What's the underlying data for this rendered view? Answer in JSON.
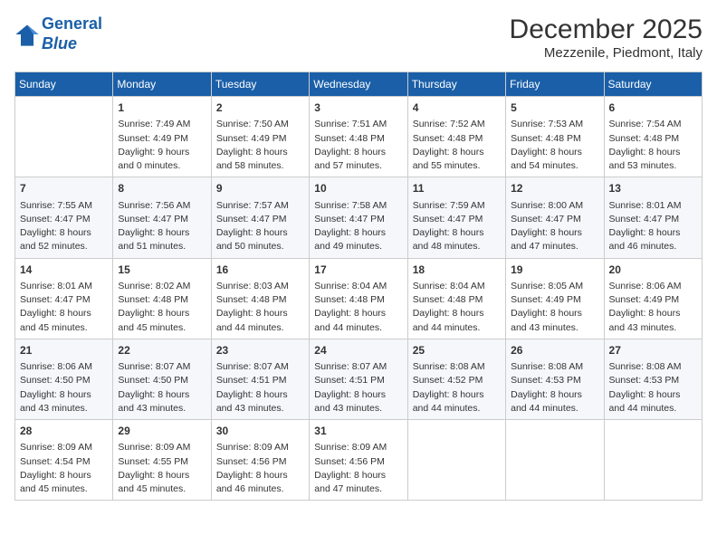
{
  "header": {
    "logo_line1": "General",
    "logo_line2": "Blue",
    "title": "December 2025",
    "subtitle": "Mezzenile, Piedmont, Italy"
  },
  "days_of_week": [
    "Sunday",
    "Monday",
    "Tuesday",
    "Wednesday",
    "Thursday",
    "Friday",
    "Saturday"
  ],
  "weeks": [
    [
      {
        "day": "",
        "info": ""
      },
      {
        "day": "1",
        "info": "Sunrise: 7:49 AM\nSunset: 4:49 PM\nDaylight: 9 hours\nand 0 minutes."
      },
      {
        "day": "2",
        "info": "Sunrise: 7:50 AM\nSunset: 4:49 PM\nDaylight: 8 hours\nand 58 minutes."
      },
      {
        "day": "3",
        "info": "Sunrise: 7:51 AM\nSunset: 4:48 PM\nDaylight: 8 hours\nand 57 minutes."
      },
      {
        "day": "4",
        "info": "Sunrise: 7:52 AM\nSunset: 4:48 PM\nDaylight: 8 hours\nand 55 minutes."
      },
      {
        "day": "5",
        "info": "Sunrise: 7:53 AM\nSunset: 4:48 PM\nDaylight: 8 hours\nand 54 minutes."
      },
      {
        "day": "6",
        "info": "Sunrise: 7:54 AM\nSunset: 4:48 PM\nDaylight: 8 hours\nand 53 minutes."
      }
    ],
    [
      {
        "day": "7",
        "info": "Sunrise: 7:55 AM\nSunset: 4:47 PM\nDaylight: 8 hours\nand 52 minutes."
      },
      {
        "day": "8",
        "info": "Sunrise: 7:56 AM\nSunset: 4:47 PM\nDaylight: 8 hours\nand 51 minutes."
      },
      {
        "day": "9",
        "info": "Sunrise: 7:57 AM\nSunset: 4:47 PM\nDaylight: 8 hours\nand 50 minutes."
      },
      {
        "day": "10",
        "info": "Sunrise: 7:58 AM\nSunset: 4:47 PM\nDaylight: 8 hours\nand 49 minutes."
      },
      {
        "day": "11",
        "info": "Sunrise: 7:59 AM\nSunset: 4:47 PM\nDaylight: 8 hours\nand 48 minutes."
      },
      {
        "day": "12",
        "info": "Sunrise: 8:00 AM\nSunset: 4:47 PM\nDaylight: 8 hours\nand 47 minutes."
      },
      {
        "day": "13",
        "info": "Sunrise: 8:01 AM\nSunset: 4:47 PM\nDaylight: 8 hours\nand 46 minutes."
      }
    ],
    [
      {
        "day": "14",
        "info": "Sunrise: 8:01 AM\nSunset: 4:47 PM\nDaylight: 8 hours\nand 45 minutes."
      },
      {
        "day": "15",
        "info": "Sunrise: 8:02 AM\nSunset: 4:48 PM\nDaylight: 8 hours\nand 45 minutes."
      },
      {
        "day": "16",
        "info": "Sunrise: 8:03 AM\nSunset: 4:48 PM\nDaylight: 8 hours\nand 44 minutes."
      },
      {
        "day": "17",
        "info": "Sunrise: 8:04 AM\nSunset: 4:48 PM\nDaylight: 8 hours\nand 44 minutes."
      },
      {
        "day": "18",
        "info": "Sunrise: 8:04 AM\nSunset: 4:48 PM\nDaylight: 8 hours\nand 44 minutes."
      },
      {
        "day": "19",
        "info": "Sunrise: 8:05 AM\nSunset: 4:49 PM\nDaylight: 8 hours\nand 43 minutes."
      },
      {
        "day": "20",
        "info": "Sunrise: 8:06 AM\nSunset: 4:49 PM\nDaylight: 8 hours\nand 43 minutes."
      }
    ],
    [
      {
        "day": "21",
        "info": "Sunrise: 8:06 AM\nSunset: 4:50 PM\nDaylight: 8 hours\nand 43 minutes."
      },
      {
        "day": "22",
        "info": "Sunrise: 8:07 AM\nSunset: 4:50 PM\nDaylight: 8 hours\nand 43 minutes."
      },
      {
        "day": "23",
        "info": "Sunrise: 8:07 AM\nSunset: 4:51 PM\nDaylight: 8 hours\nand 43 minutes."
      },
      {
        "day": "24",
        "info": "Sunrise: 8:07 AM\nSunset: 4:51 PM\nDaylight: 8 hours\nand 43 minutes."
      },
      {
        "day": "25",
        "info": "Sunrise: 8:08 AM\nSunset: 4:52 PM\nDaylight: 8 hours\nand 44 minutes."
      },
      {
        "day": "26",
        "info": "Sunrise: 8:08 AM\nSunset: 4:53 PM\nDaylight: 8 hours\nand 44 minutes."
      },
      {
        "day": "27",
        "info": "Sunrise: 8:08 AM\nSunset: 4:53 PM\nDaylight: 8 hours\nand 44 minutes."
      }
    ],
    [
      {
        "day": "28",
        "info": "Sunrise: 8:09 AM\nSunset: 4:54 PM\nDaylight: 8 hours\nand 45 minutes."
      },
      {
        "day": "29",
        "info": "Sunrise: 8:09 AM\nSunset: 4:55 PM\nDaylight: 8 hours\nand 45 minutes."
      },
      {
        "day": "30",
        "info": "Sunrise: 8:09 AM\nSunset: 4:56 PM\nDaylight: 8 hours\nand 46 minutes."
      },
      {
        "day": "31",
        "info": "Sunrise: 8:09 AM\nSunset: 4:56 PM\nDaylight: 8 hours\nand 47 minutes."
      },
      {
        "day": "",
        "info": ""
      },
      {
        "day": "",
        "info": ""
      },
      {
        "day": "",
        "info": ""
      }
    ]
  ]
}
